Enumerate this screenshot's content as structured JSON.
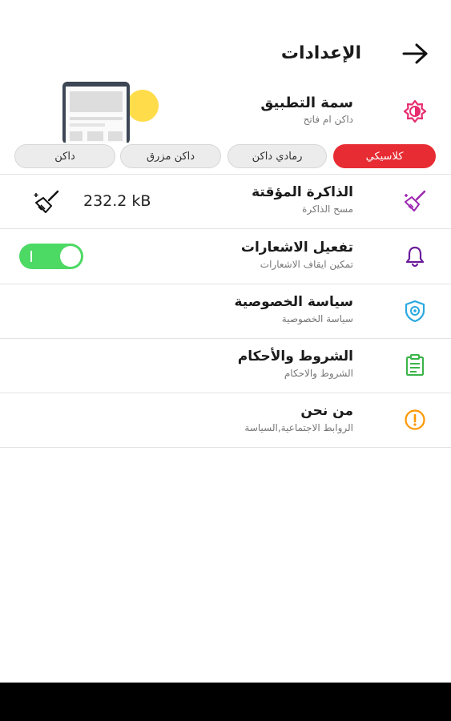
{
  "header": {
    "title": "الإعدادات",
    "back_icon": "arrow-right-icon"
  },
  "theme": {
    "title": "سمة التطبيق",
    "subtitle": "داكن ام فاتح",
    "icon": "theme-brightness-icon",
    "options": [
      {
        "label": "كلاسيكي",
        "selected": true
      },
      {
        "label": "رمادي داكن",
        "selected": false
      },
      {
        "label": "داكن مزرق",
        "selected": false
      },
      {
        "label": "داكن",
        "selected": false
      }
    ],
    "accent": "#e72c33"
  },
  "rows": {
    "cache": {
      "title": "الذاكرة المؤقتة",
      "subtitle": "مسح الذاكرة",
      "value": "232.2 kB",
      "icon": "broom-icon"
    },
    "notifications": {
      "title": "تفعيل الاشعارات",
      "subtitle": "تمكين ايقاف الاشعارات",
      "enabled": true,
      "icon": "bell-icon"
    },
    "privacy": {
      "title": "سياسة الخصوصية",
      "subtitle": "سياسة الخصوصية",
      "icon": "shield-icon"
    },
    "terms": {
      "title": "الشروط والأحكام",
      "subtitle": "الشروط والاحكام",
      "icon": "clipboard-icon"
    },
    "about": {
      "title": "من نحن",
      "subtitle": "الروابط الاجتماعية,السياسة",
      "icon": "info-icon"
    }
  },
  "colors": {
    "theme_icon": "#e72c6f",
    "cache_icon": "#9c27b0",
    "bell_icon": "#6a1b9a",
    "shield_icon": "#29a8e0",
    "clipboard_icon": "#3bb54a",
    "info_icon": "#ff9800",
    "toggle_on": "#4cd964"
  }
}
